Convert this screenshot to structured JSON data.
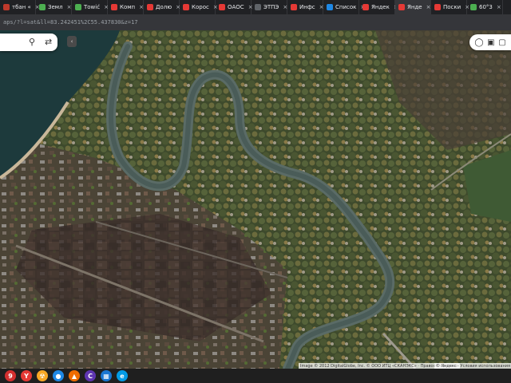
{
  "tabs": [
    {
      "label": "тбан «",
      "color": "#c0392b"
    },
    {
      "label": "Земл",
      "color": "#4caf50"
    },
    {
      "label": "Тowić",
      "color": "#4caf50"
    },
    {
      "label": "Комп",
      "color": "#e53935"
    },
    {
      "label": "Долю",
      "color": "#e53935"
    },
    {
      "label": "Корос",
      "color": "#e53935"
    },
    {
      "label": "ОАОС",
      "color": "#e53935"
    },
    {
      "label": "ЭТПЭ",
      "color": "#5f6368"
    },
    {
      "label": "Инфс",
      "color": "#e53935"
    },
    {
      "label": "Список",
      "color": "#1e88e5"
    },
    {
      "label": "Яндек",
      "color": "#e53935"
    },
    {
      "label": "Янде",
      "color": "#e53935",
      "active": true
    },
    {
      "label": "Поски",
      "color": "#e53935"
    },
    {
      "label": "60°3",
      "color": "#4caf50"
    }
  ],
  "address": {
    "url": "aps/?l=sat&ll=83.242451%2C55.437830&z=17"
  },
  "map_controls": {
    "search_icon": "search-icon",
    "route_icon": "route-icon",
    "collapse_label": "‹",
    "layers_icon": "layers-icon",
    "panorama_icon": "panorama-icon",
    "share_icon": "share-icon"
  },
  "attribution": {
    "text": "Image © 2012 DigitalGlobe, Inc. © ООО ИТЦ «СКАНЭКС» · Правообладатели",
    "text2": "© Яндекс · Условия использования · Карты"
  },
  "taskbar": [
    {
      "label": "9",
      "color": "#d32f2f",
      "name": "app-9"
    },
    {
      "label": "Y",
      "color": "#e53935",
      "name": "yandex-browser"
    },
    {
      "label": "☢",
      "color": "#f9a825",
      "name": "app-radiation"
    },
    {
      "label": "●",
      "color": "#1e88e5",
      "name": "app-blue"
    },
    {
      "label": "▲",
      "color": "#ef6c00",
      "name": "brave-browser"
    },
    {
      "label": "C",
      "color": "#5e35b1",
      "name": "app-c"
    },
    {
      "label": "▦",
      "color": "#1976d2",
      "name": "app-grid"
    },
    {
      "label": "e",
      "color": "#039be5",
      "name": "app-e"
    }
  ]
}
